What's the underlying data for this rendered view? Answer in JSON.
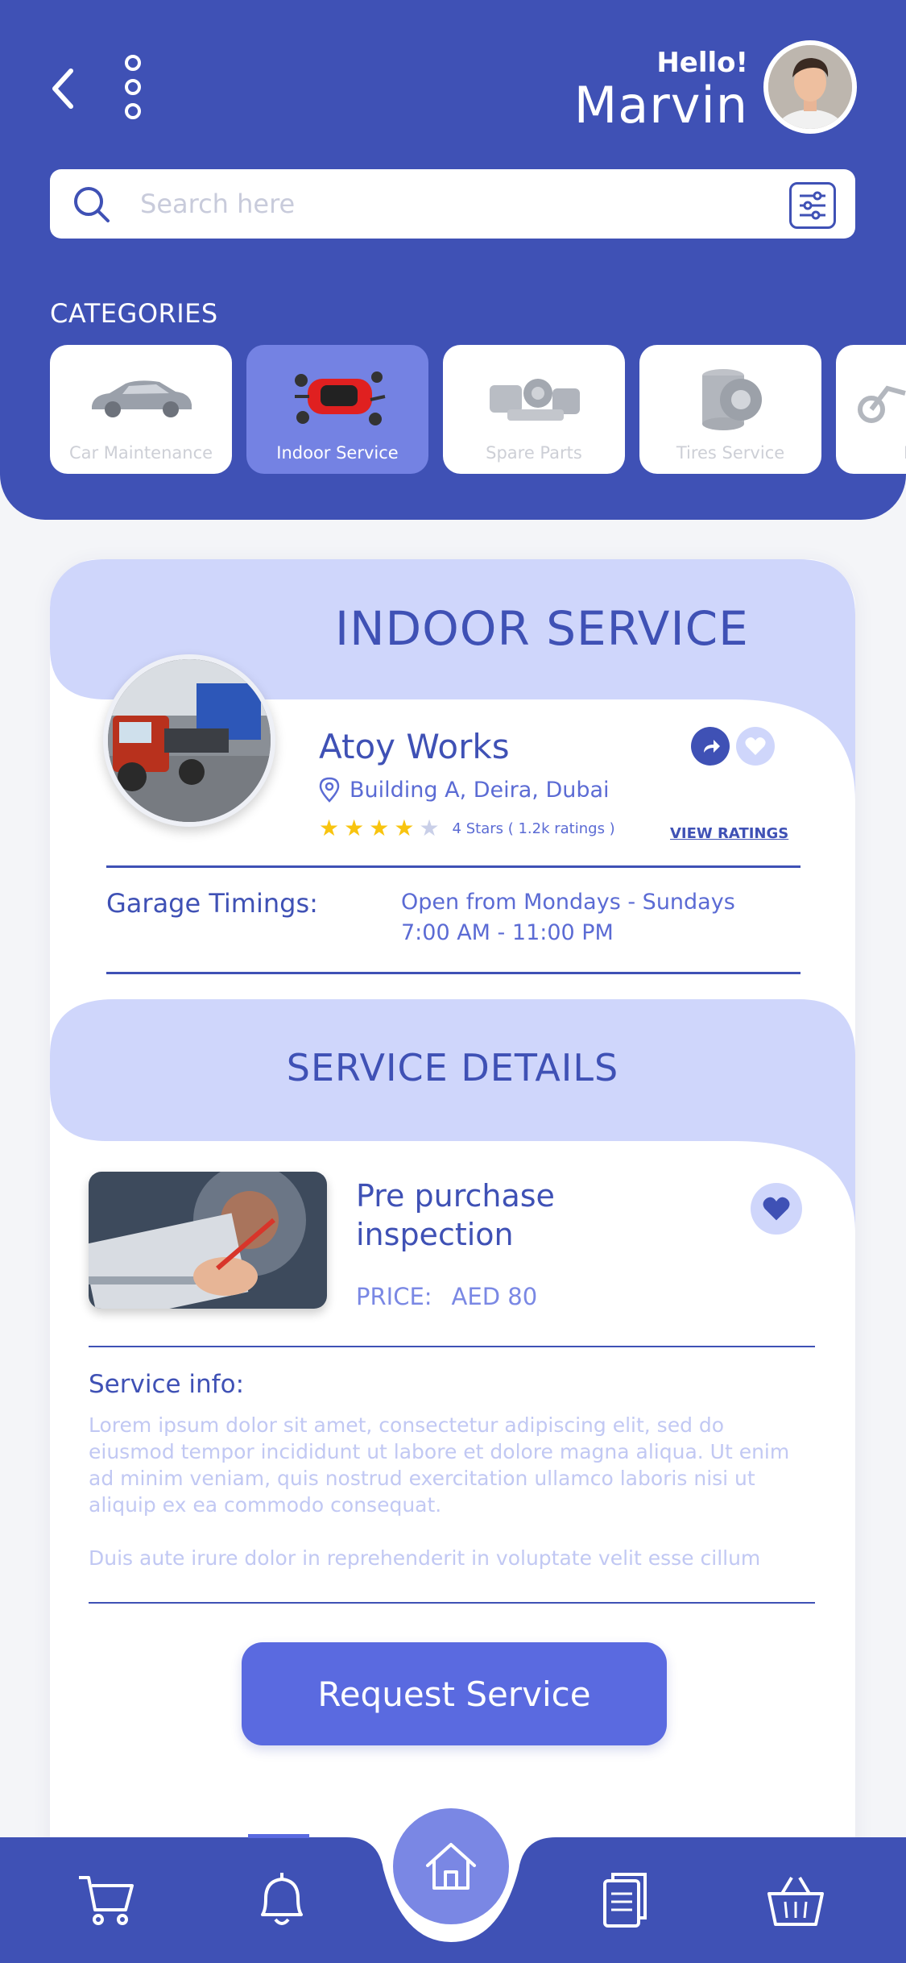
{
  "header": {
    "greeting": "Hello!",
    "user_name": "Marvin"
  },
  "search": {
    "placeholder": "Search here"
  },
  "categories": {
    "title": "CATEGORIES",
    "items": [
      {
        "label": "Car Maintenance",
        "active": false
      },
      {
        "label": "Indoor Service",
        "active": true
      },
      {
        "label": "Spare Parts",
        "active": false
      },
      {
        "label": "Tires Service",
        "active": false
      },
      {
        "label": "M",
        "active": false
      }
    ]
  },
  "garage": {
    "section_title": "INDOOR SERVICE",
    "name": "Atoy Works",
    "address": "Building A, Deira, Dubai",
    "rating_stars": 4,
    "rating_text": "4 Stars ( 1.2k ratings )",
    "view_ratings": "VIEW RATINGS",
    "timings_label": "Garage Timings:",
    "timings_days": "Open from Mondays - Sundays",
    "timings_hours": "7:00 AM - 11:00 PM"
  },
  "service": {
    "section_title": "SERVICE DETAILS",
    "name": "Pre purchase inspection",
    "price_label": "PRICE:",
    "price_value": "AED 80",
    "info_title": "Service info:",
    "info_para1": "Lorem ipsum dolor sit amet, consectetur adipiscing elit, sed do eiusmod tempor incididunt ut labore et dolore magna aliqua. Ut enim ad minim veniam, quis nostrud exercitation ullamco laboris nisi ut aliquip ex ea commodo consequat.",
    "info_para2": "Duis aute irure dolor in reprehenderit in voluptate velit esse cillum",
    "request_button": "Request Service"
  },
  "nav": {
    "items": [
      "cart-icon",
      "bell-icon",
      "home-icon",
      "document-icon",
      "basket-icon"
    ],
    "active": "bell-icon"
  },
  "colors": {
    "primary": "#3f51b5",
    "accent": "#5a6ae0",
    "light": "#cfd6fb",
    "star": "#f8c40f"
  }
}
